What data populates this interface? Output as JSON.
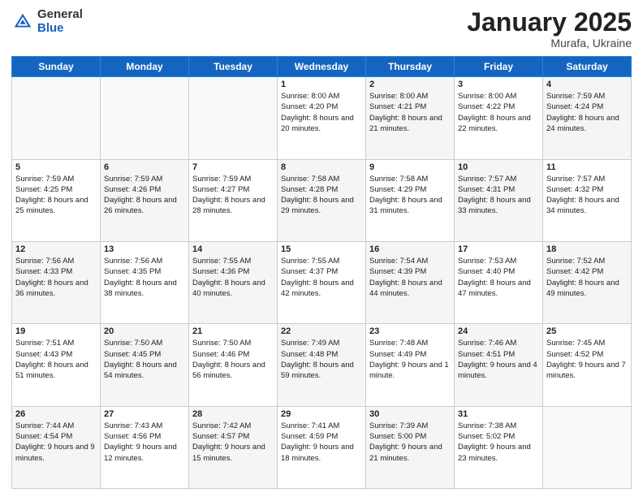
{
  "logo": {
    "general": "General",
    "blue": "Blue"
  },
  "header": {
    "title": "January 2025",
    "subtitle": "Murafa, Ukraine"
  },
  "weekdays": [
    "Sunday",
    "Monday",
    "Tuesday",
    "Wednesday",
    "Thursday",
    "Friday",
    "Saturday"
  ],
  "weeks": [
    [
      {
        "day": "",
        "sunrise": "",
        "sunset": "",
        "daylight": "",
        "shaded": false,
        "empty": true
      },
      {
        "day": "",
        "sunrise": "",
        "sunset": "",
        "daylight": "",
        "shaded": false,
        "empty": true
      },
      {
        "day": "",
        "sunrise": "",
        "sunset": "",
        "daylight": "",
        "shaded": false,
        "empty": true
      },
      {
        "day": "1",
        "sunrise": "Sunrise: 8:00 AM",
        "sunset": "Sunset: 4:20 PM",
        "daylight": "Daylight: 8 hours and 20 minutes.",
        "shaded": false,
        "empty": false
      },
      {
        "day": "2",
        "sunrise": "Sunrise: 8:00 AM",
        "sunset": "Sunset: 4:21 PM",
        "daylight": "Daylight: 8 hours and 21 minutes.",
        "shaded": true,
        "empty": false
      },
      {
        "day": "3",
        "sunrise": "Sunrise: 8:00 AM",
        "sunset": "Sunset: 4:22 PM",
        "daylight": "Daylight: 8 hours and 22 minutes.",
        "shaded": false,
        "empty": false
      },
      {
        "day": "4",
        "sunrise": "Sunrise: 7:59 AM",
        "sunset": "Sunset: 4:24 PM",
        "daylight": "Daylight: 8 hours and 24 minutes.",
        "shaded": true,
        "empty": false
      }
    ],
    [
      {
        "day": "5",
        "sunrise": "Sunrise: 7:59 AM",
        "sunset": "Sunset: 4:25 PM",
        "daylight": "Daylight: 8 hours and 25 minutes.",
        "shaded": false,
        "empty": false
      },
      {
        "day": "6",
        "sunrise": "Sunrise: 7:59 AM",
        "sunset": "Sunset: 4:26 PM",
        "daylight": "Daylight: 8 hours and 26 minutes.",
        "shaded": true,
        "empty": false
      },
      {
        "day": "7",
        "sunrise": "Sunrise: 7:59 AM",
        "sunset": "Sunset: 4:27 PM",
        "daylight": "Daylight: 8 hours and 28 minutes.",
        "shaded": false,
        "empty": false
      },
      {
        "day": "8",
        "sunrise": "Sunrise: 7:58 AM",
        "sunset": "Sunset: 4:28 PM",
        "daylight": "Daylight: 8 hours and 29 minutes.",
        "shaded": true,
        "empty": false
      },
      {
        "day": "9",
        "sunrise": "Sunrise: 7:58 AM",
        "sunset": "Sunset: 4:29 PM",
        "daylight": "Daylight: 8 hours and 31 minutes.",
        "shaded": false,
        "empty": false
      },
      {
        "day": "10",
        "sunrise": "Sunrise: 7:57 AM",
        "sunset": "Sunset: 4:31 PM",
        "daylight": "Daylight: 8 hours and 33 minutes.",
        "shaded": true,
        "empty": false
      },
      {
        "day": "11",
        "sunrise": "Sunrise: 7:57 AM",
        "sunset": "Sunset: 4:32 PM",
        "daylight": "Daylight: 8 hours and 34 minutes.",
        "shaded": false,
        "empty": false
      }
    ],
    [
      {
        "day": "12",
        "sunrise": "Sunrise: 7:56 AM",
        "sunset": "Sunset: 4:33 PM",
        "daylight": "Daylight: 8 hours and 36 minutes.",
        "shaded": true,
        "empty": false
      },
      {
        "day": "13",
        "sunrise": "Sunrise: 7:56 AM",
        "sunset": "Sunset: 4:35 PM",
        "daylight": "Daylight: 8 hours and 38 minutes.",
        "shaded": false,
        "empty": false
      },
      {
        "day": "14",
        "sunrise": "Sunrise: 7:55 AM",
        "sunset": "Sunset: 4:36 PM",
        "daylight": "Daylight: 8 hours and 40 minutes.",
        "shaded": true,
        "empty": false
      },
      {
        "day": "15",
        "sunrise": "Sunrise: 7:55 AM",
        "sunset": "Sunset: 4:37 PM",
        "daylight": "Daylight: 8 hours and 42 minutes.",
        "shaded": false,
        "empty": false
      },
      {
        "day": "16",
        "sunrise": "Sunrise: 7:54 AM",
        "sunset": "Sunset: 4:39 PM",
        "daylight": "Daylight: 8 hours and 44 minutes.",
        "shaded": true,
        "empty": false
      },
      {
        "day": "17",
        "sunrise": "Sunrise: 7:53 AM",
        "sunset": "Sunset: 4:40 PM",
        "daylight": "Daylight: 8 hours and 47 minutes.",
        "shaded": false,
        "empty": false
      },
      {
        "day": "18",
        "sunrise": "Sunrise: 7:52 AM",
        "sunset": "Sunset: 4:42 PM",
        "daylight": "Daylight: 8 hours and 49 minutes.",
        "shaded": true,
        "empty": false
      }
    ],
    [
      {
        "day": "19",
        "sunrise": "Sunrise: 7:51 AM",
        "sunset": "Sunset: 4:43 PM",
        "daylight": "Daylight: 8 hours and 51 minutes.",
        "shaded": false,
        "empty": false
      },
      {
        "day": "20",
        "sunrise": "Sunrise: 7:50 AM",
        "sunset": "Sunset: 4:45 PM",
        "daylight": "Daylight: 8 hours and 54 minutes.",
        "shaded": true,
        "empty": false
      },
      {
        "day": "21",
        "sunrise": "Sunrise: 7:50 AM",
        "sunset": "Sunset: 4:46 PM",
        "daylight": "Daylight: 8 hours and 56 minutes.",
        "shaded": false,
        "empty": false
      },
      {
        "day": "22",
        "sunrise": "Sunrise: 7:49 AM",
        "sunset": "Sunset: 4:48 PM",
        "daylight": "Daylight: 8 hours and 59 minutes.",
        "shaded": true,
        "empty": false
      },
      {
        "day": "23",
        "sunrise": "Sunrise: 7:48 AM",
        "sunset": "Sunset: 4:49 PM",
        "daylight": "Daylight: 9 hours and 1 minute.",
        "shaded": false,
        "empty": false
      },
      {
        "day": "24",
        "sunrise": "Sunrise: 7:46 AM",
        "sunset": "Sunset: 4:51 PM",
        "daylight": "Daylight: 9 hours and 4 minutes.",
        "shaded": true,
        "empty": false
      },
      {
        "day": "25",
        "sunrise": "Sunrise: 7:45 AM",
        "sunset": "Sunset: 4:52 PM",
        "daylight": "Daylight: 9 hours and 7 minutes.",
        "shaded": false,
        "empty": false
      }
    ],
    [
      {
        "day": "26",
        "sunrise": "Sunrise: 7:44 AM",
        "sunset": "Sunset: 4:54 PM",
        "daylight": "Daylight: 9 hours and 9 minutes.",
        "shaded": true,
        "empty": false
      },
      {
        "day": "27",
        "sunrise": "Sunrise: 7:43 AM",
        "sunset": "Sunset: 4:56 PM",
        "daylight": "Daylight: 9 hours and 12 minutes.",
        "shaded": false,
        "empty": false
      },
      {
        "day": "28",
        "sunrise": "Sunrise: 7:42 AM",
        "sunset": "Sunset: 4:57 PM",
        "daylight": "Daylight: 9 hours and 15 minutes.",
        "shaded": true,
        "empty": false
      },
      {
        "day": "29",
        "sunrise": "Sunrise: 7:41 AM",
        "sunset": "Sunset: 4:59 PM",
        "daylight": "Daylight: 9 hours and 18 minutes.",
        "shaded": false,
        "empty": false
      },
      {
        "day": "30",
        "sunrise": "Sunrise: 7:39 AM",
        "sunset": "Sunset: 5:00 PM",
        "daylight": "Daylight: 9 hours and 21 minutes.",
        "shaded": true,
        "empty": false
      },
      {
        "day": "31",
        "sunrise": "Sunrise: 7:38 AM",
        "sunset": "Sunset: 5:02 PM",
        "daylight": "Daylight: 9 hours and 23 minutes.",
        "shaded": false,
        "empty": false
      },
      {
        "day": "",
        "sunrise": "",
        "sunset": "",
        "daylight": "",
        "shaded": true,
        "empty": true
      }
    ]
  ]
}
